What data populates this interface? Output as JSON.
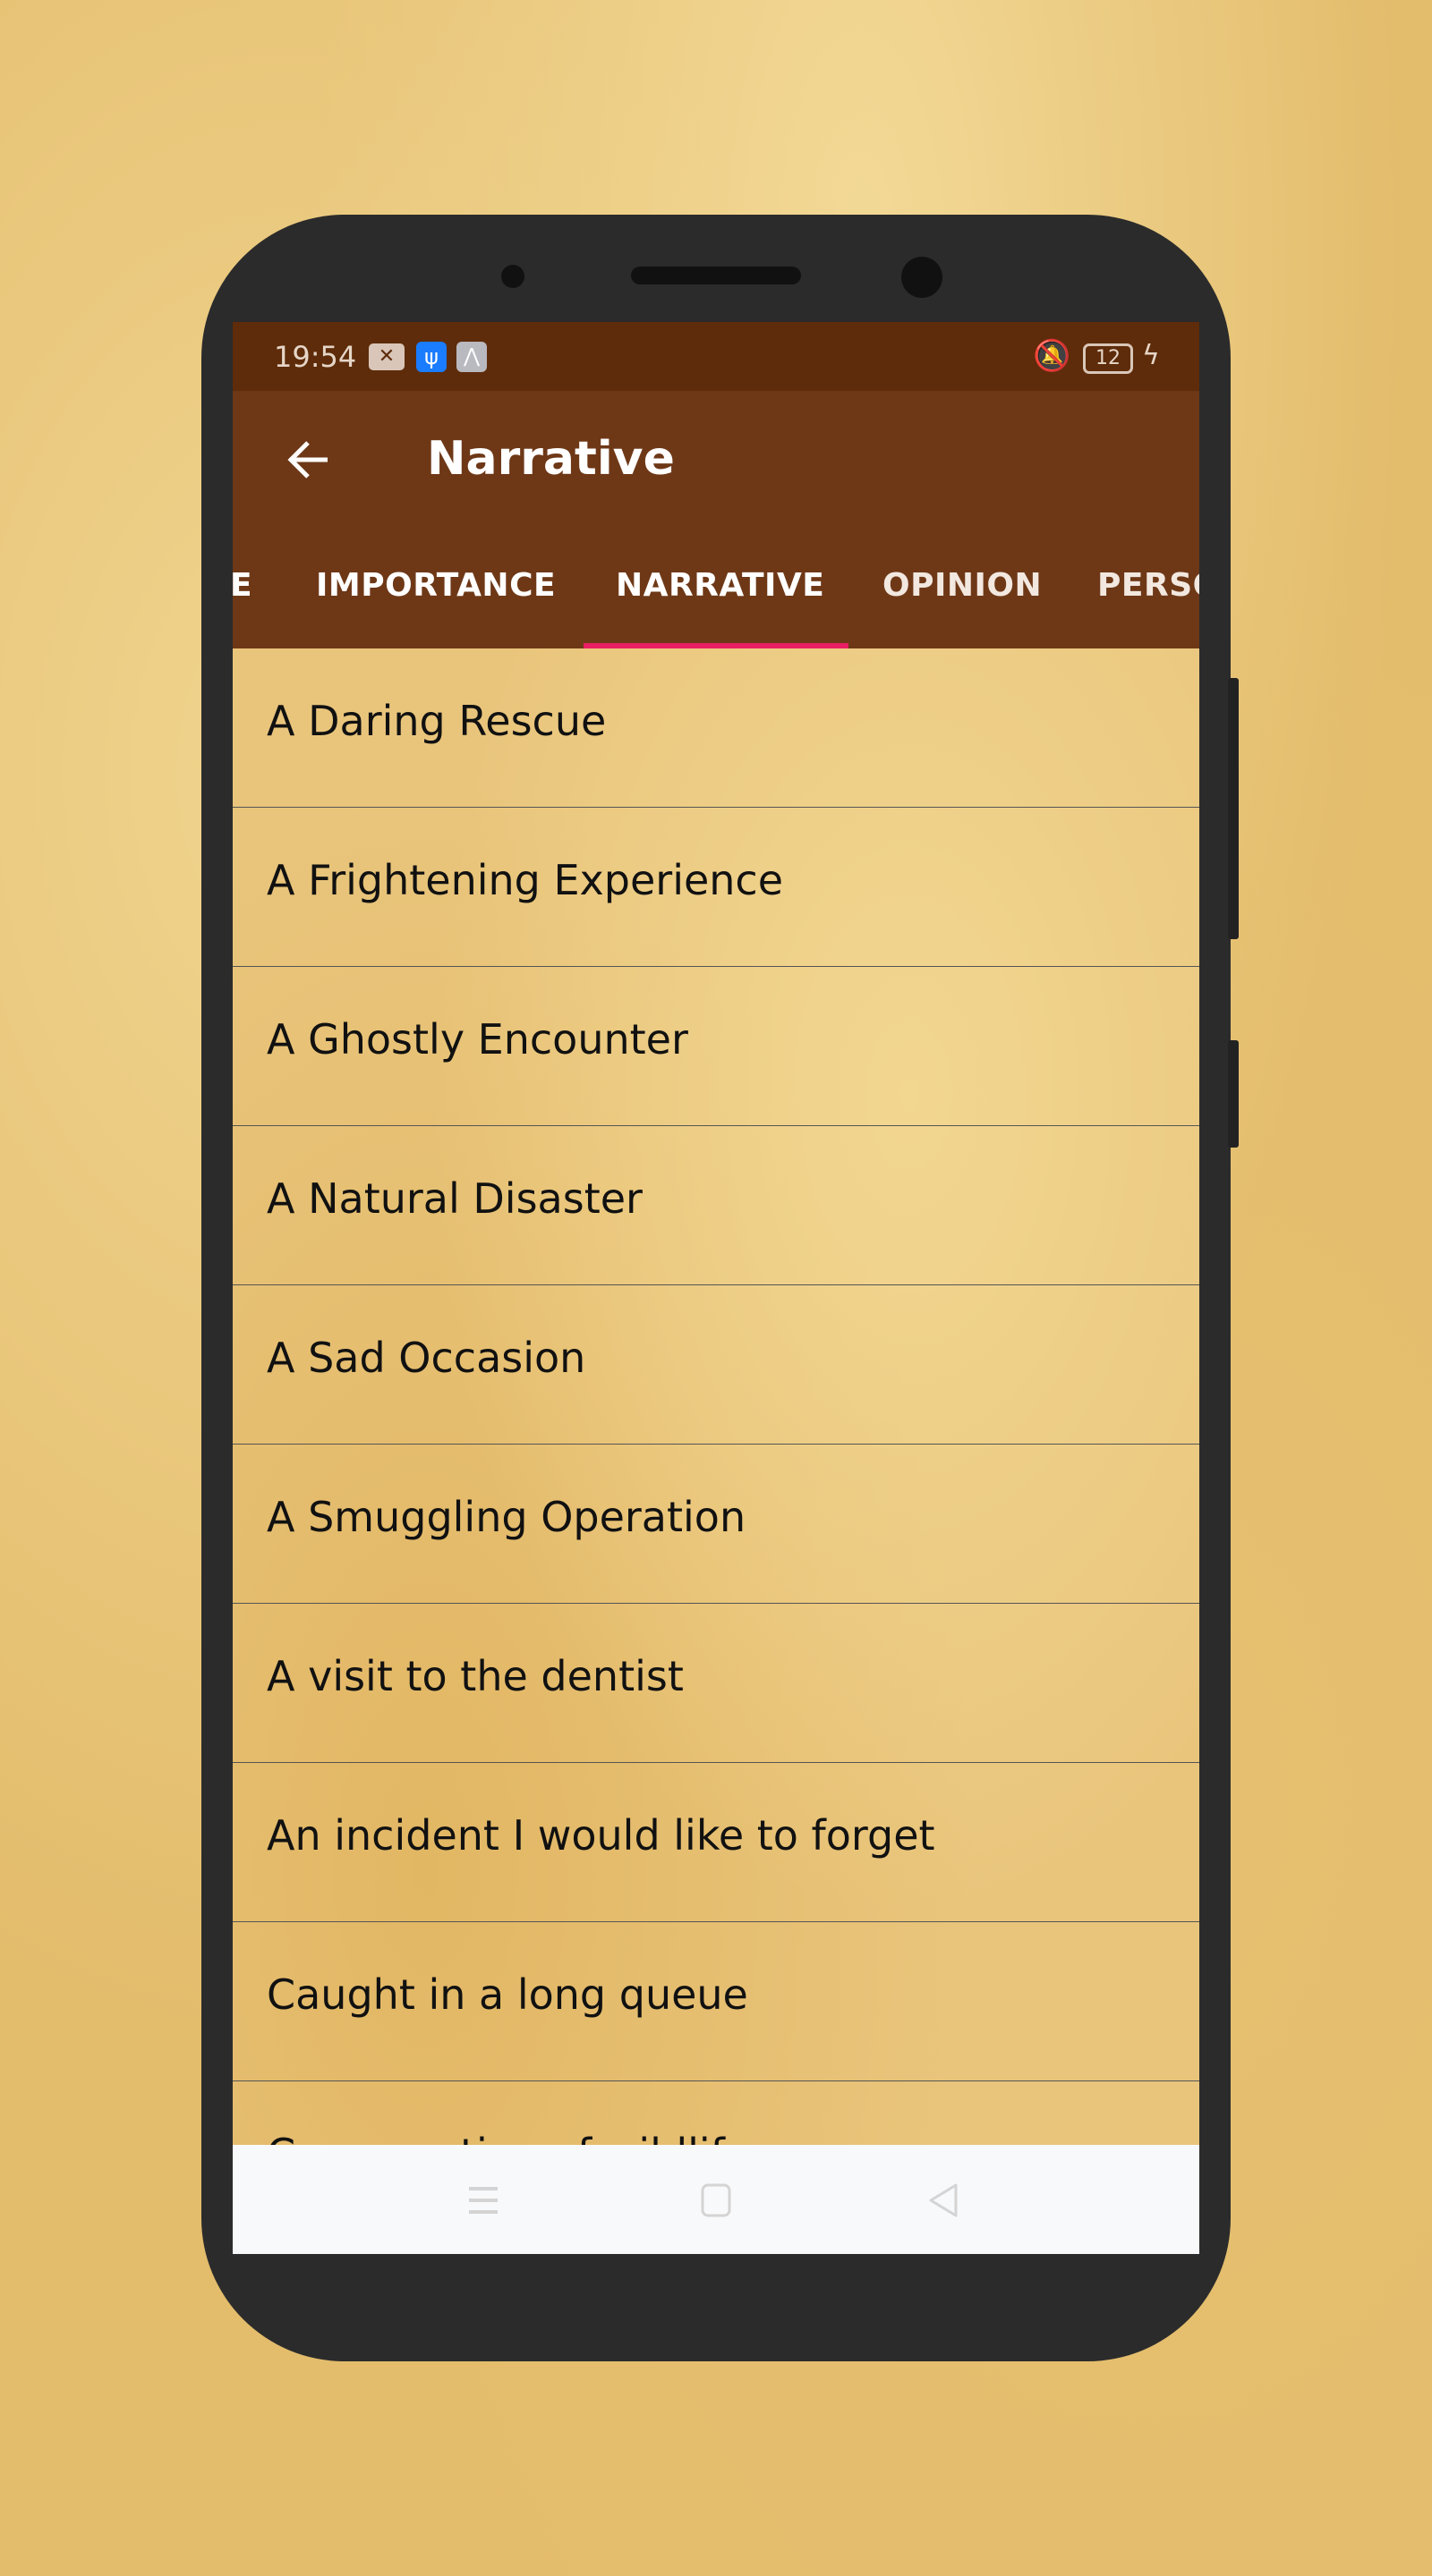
{
  "status_bar": {
    "time": "19:54",
    "battery": "12",
    "icons": [
      "sim-error-icon",
      "usb-icon",
      "share-icon",
      "vibrate-off-icon",
      "battery-icon",
      "charging-icon"
    ]
  },
  "app_bar": {
    "title": "Narrative",
    "back_icon": "arrow-left-icon"
  },
  "tabs": [
    {
      "label": "E"
    },
    {
      "label": "IMPORTANCE"
    },
    {
      "label": "NARRATIVE",
      "selected": true
    },
    {
      "label": "OPINION"
    },
    {
      "label": "PERSO"
    }
  ],
  "list": [
    {
      "label": "A Daring Rescue"
    },
    {
      "label": "A Frightening Experience"
    },
    {
      "label": "A Ghostly Encounter"
    },
    {
      "label": "A Natural Disaster"
    },
    {
      "label": "A Sad Occasion"
    },
    {
      "label": "A Smuggling Operation"
    },
    {
      "label": "A visit to the dentist"
    },
    {
      "label": "An incident I would like to forget"
    },
    {
      "label": "Caught in a long queue"
    },
    {
      "label": "Conservation of wildlife"
    }
  ],
  "colors": {
    "status_bar": "#5e2c0a",
    "app_bar": "#6e3817",
    "indicator": "#e91e63",
    "nav_bar": "#f8f9fa"
  }
}
